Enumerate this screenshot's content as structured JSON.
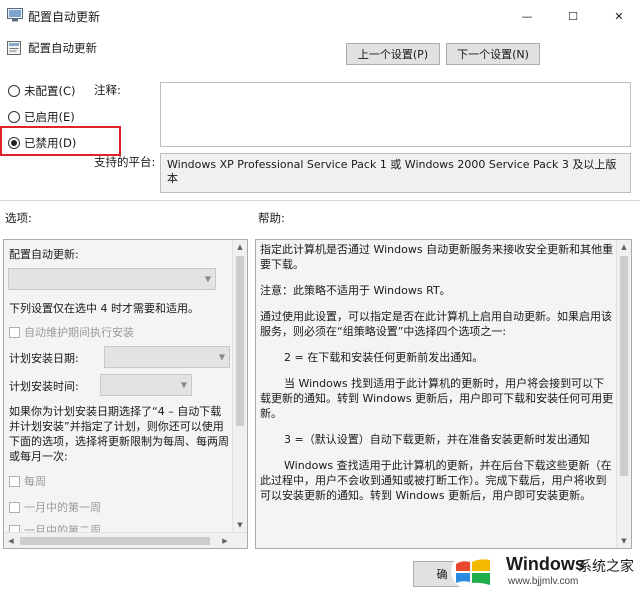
{
  "window": {
    "title": "配置自动更新",
    "minimize_glyph": "—",
    "maximize_glyph": "☐",
    "close_glyph": "✕"
  },
  "header": {
    "title": "配置自动更新",
    "prev_button": "上一个设置(P)",
    "next_button": "下一个设置(N)"
  },
  "state": {
    "options": [
      {
        "label": "未配置(C)",
        "selected": false
      },
      {
        "label": "已启用(E)",
        "selected": false
      },
      {
        "label": "已禁用(D)",
        "selected": true
      }
    ]
  },
  "comment": {
    "label": "注释:",
    "value": ""
  },
  "platform": {
    "label": "支持的平台:",
    "value": "Windows XP Professional Service Pack 1 或 Windows 2000 Service Pack 3 及以上版本"
  },
  "options_section": {
    "label": "选项:",
    "title": "配置自动更新:",
    "note": "下列设置仅在选中 4 时才需要和适用。",
    "maintenance_checkbox": "自动维护期间执行安装",
    "schedule_day_label": "计划安装日期:",
    "schedule_time_label": "计划安装时间:",
    "desc_lines": [
      "如果你为计划安装日期选择了“4 – 自动下载",
      "并计划安装”并指定了计划，则你还可以使用",
      "下面的选项，选择将更新限制为每周、每两周",
      "或每月一次:"
    ],
    "weekly": "每周",
    "first_week": "一月中的第一周",
    "second_week": "一月中的第二周"
  },
  "help_section": {
    "label": "帮助:",
    "paragraphs": [
      "指定此计算机是否通过 Windows 自动更新服务来接收安全更新和其他重要下载。",
      "注意：此策略不适用于 Windows RT。",
      "通过使用此设置，可以指定是否在此计算机上启用自动更新。如果启用该服务，则必须在“组策略设置”中选择四个选项之一:",
      "2 = 在下载和安装任何更新前发出通知。",
      "当 Windows 找到适用于此计算机的更新时，用户将会接到可以下载更新的通知。转到 Windows 更新后，用户即可下载和安装任何可用更新。",
      "3 =（默认设置）自动下载更新，并在准备安装更新时发出通知",
      "Windows 查找适用于此计算机的更新，并在后台下载这些更新（在此过程中，用户不会收到通知或被打断工作）。完成下载后，用户将收到可以安装更新的通知。转到 Windows 更新后，用户即可安装更新。"
    ]
  },
  "footer": {
    "ok_button": "确"
  },
  "watermark": {
    "brand": "Windows",
    "chinese": "系统之家",
    "url": "www.bjjmlv.com"
  },
  "colors": {
    "highlight_box": "#e0232a",
    "panel_bg": "#f4f4f4",
    "button_bg": "#e1e1e1"
  }
}
